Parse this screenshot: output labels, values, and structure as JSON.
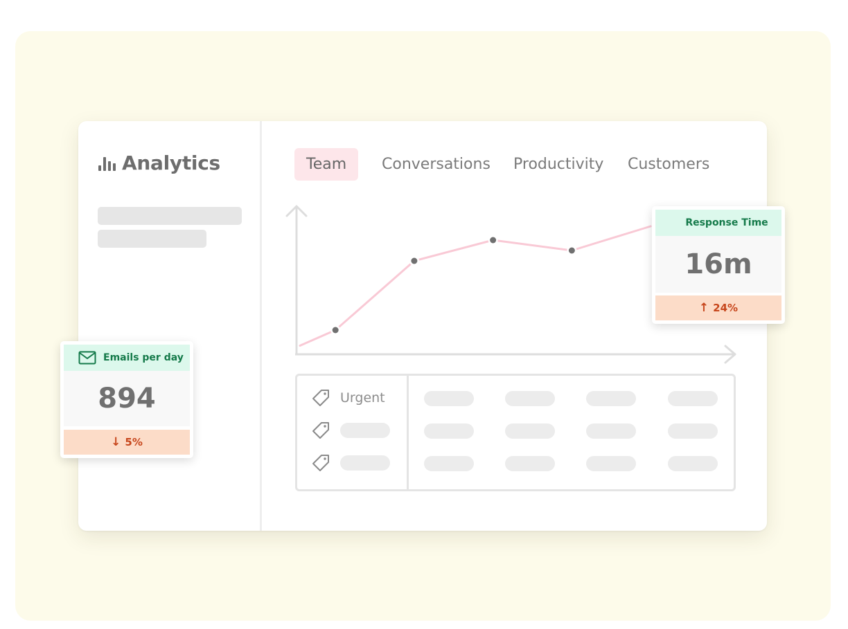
{
  "sidebar": {
    "title": "Analytics",
    "title_icon": "bar-chart-icon"
  },
  "tabs": [
    {
      "label": "Team",
      "active": true
    },
    {
      "label": "Conversations",
      "active": false
    },
    {
      "label": "Productivity",
      "active": false
    },
    {
      "label": "Customers",
      "active": false
    }
  ],
  "chart_data": {
    "type": "line",
    "title": "",
    "xlabel": "",
    "ylabel": "",
    "x": [
      1,
      2,
      3,
      4,
      5
    ],
    "series": [
      {
        "values": [
          1.0,
          3.0,
          3.6,
          3.3,
          4.0
        ],
        "color": "#f9c9d5",
        "marker_color": "#707070"
      }
    ],
    "ylim": [
      0,
      5
    ],
    "grid": false,
    "axis_color": "#dddddd"
  },
  "table": {
    "rows": [
      {
        "tag_icon": "tag-icon",
        "label": "Urgent"
      },
      {
        "tag_icon": "tag-icon",
        "label": ""
      },
      {
        "tag_icon": "tag-icon",
        "label": ""
      }
    ]
  },
  "response_time": {
    "header": "Response Time",
    "value": "16m",
    "change": "24%",
    "direction": "up",
    "direction_icon": "arrow-up-icon",
    "change_color": "#c7471d"
  },
  "emails": {
    "header": "Emails per day",
    "header_icon": "envelope-icon",
    "value": "894",
    "change": "5%",
    "direction": "down",
    "direction_icon": "arrow-down-icon",
    "change_color": "#c7471d"
  },
  "colors": {
    "background_panel": "#fdfbea",
    "active_tab": "#fde6ea",
    "stat_header": "#dcf8ec",
    "stat_footer": "#fcdcc8"
  }
}
